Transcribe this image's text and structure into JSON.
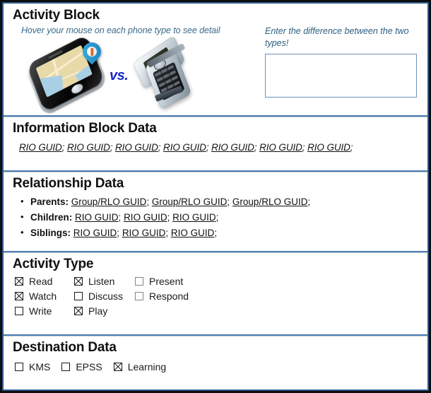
{
  "activity_block": {
    "title": "Activity Block",
    "hover_hint": "Hover your mouse on each phone type to see detail",
    "vs_label": "vs.",
    "smartphone_icon": "smartphone-map-icon",
    "flipphone_icon": "flip-phone-icon",
    "enter_hint": "Enter the difference between the two types!",
    "answer_value": "",
    "answer_placeholder": ""
  },
  "information_block": {
    "title": "Information Block Data",
    "guid_label": "RIO GUID",
    "separator": ";",
    "guids": [
      "RIO GUID",
      "RIO GUID",
      "RIO GUID",
      "RIO GUID",
      "RIO GUID",
      "RIO GUID",
      "RIO GUID"
    ]
  },
  "relationship_block": {
    "title": "Relationship Data",
    "rows": [
      {
        "label": "Parents:",
        "guids": [
          "Group/RLO GUID",
          "Group/RLO GUID",
          "Group/RLO GUID"
        ]
      },
      {
        "label": "Children:",
        "guids": [
          "RIO GUID",
          "RIO GUID",
          "RIO GUID"
        ]
      },
      {
        "label": "Siblings:",
        "guids": [
          "RIO GUID",
          "RIO GUID",
          "RIO GUID"
        ]
      }
    ]
  },
  "activity_type": {
    "title": "Activity Type",
    "rows": [
      [
        {
          "label": "Read",
          "checked": true,
          "muted": false
        },
        {
          "label": "Listen",
          "checked": true,
          "muted": false
        },
        {
          "label": "Present",
          "checked": false,
          "muted": true
        }
      ],
      [
        {
          "label": "Watch",
          "checked": true,
          "muted": false
        },
        {
          "label": "Discuss",
          "checked": false,
          "muted": false
        },
        {
          "label": "Respond",
          "checked": false,
          "muted": true
        }
      ],
      [
        {
          "label": "Write",
          "checked": false,
          "muted": false
        },
        {
          "label": "Play",
          "checked": true,
          "muted": false
        },
        {
          "label": "",
          "checked": false,
          "muted": false
        }
      ]
    ]
  },
  "destination_block": {
    "title": "Destination Data",
    "options": [
      {
        "label": "KMS",
        "checked": false
      },
      {
        "label": "EPSS",
        "checked": false
      },
      {
        "label": "Learning",
        "checked": true
      }
    ]
  },
  "colors": {
    "frame_outer": "#0d0d0d",
    "frame_inner": "#2e5a8e",
    "divider": "#4a7cb5",
    "hint_text": "#3a6b8c",
    "vs_text": "#1a27c8",
    "input_border": "#7091b4"
  }
}
